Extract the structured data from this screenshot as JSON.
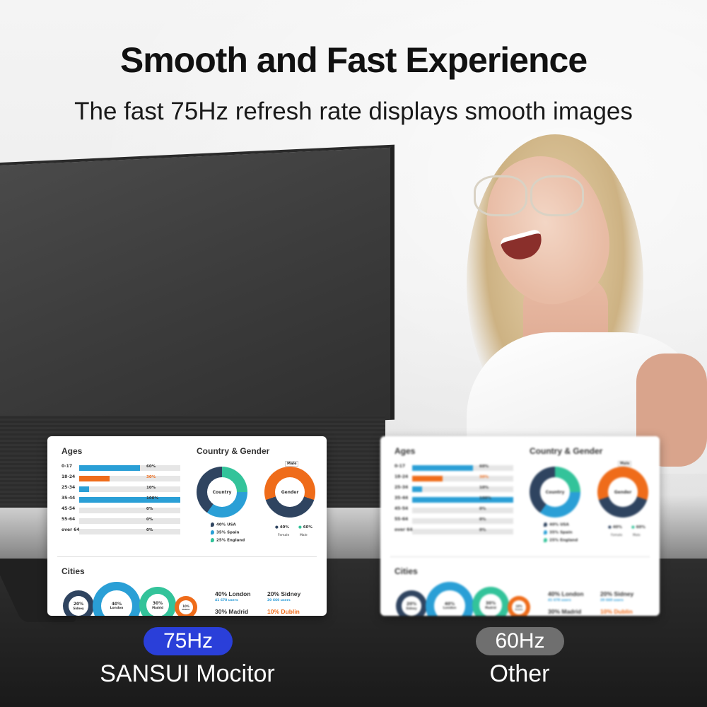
{
  "headline": "Smooth and Fast Experience",
  "subheadline": "The fast 75Hz refresh rate displays smooth images",
  "colors": {
    "blue": "#2a9fd6",
    "orange": "#ef6c1a",
    "teal": "#33c39a",
    "navy": "#2f4460",
    "badge_75": "#2a3fd9",
    "badge_60": "#6f6f6f"
  },
  "dashboard": {
    "ages_title": "Ages",
    "country_gender_title": "Country & Gender",
    "cities_title": "Cities",
    "ages": [
      {
        "label": "0-17",
        "pct": "60%",
        "value": 0.6,
        "color": "#2a9fd6"
      },
      {
        "label": "18-24",
        "pct": "30%",
        "value": 0.3,
        "color": "#ef6c1a"
      },
      {
        "label": "25-34",
        "pct": "10%",
        "value": 0.1,
        "color": "#2a9fd6"
      },
      {
        "label": "35-44",
        "pct": "100%",
        "value": 1.0,
        "color": "#2a9fd6"
      },
      {
        "label": "45-54",
        "pct": "0%",
        "value": 0,
        "color": "#2a9fd6"
      },
      {
        "label": "55-64",
        "pct": "0%",
        "value": 0,
        "color": "#2a9fd6"
      },
      {
        "label": "over 64",
        "pct": "0%",
        "value": 0,
        "color": "#2a9fd6"
      }
    ],
    "country_donut": {
      "label": "Country",
      "pct_left": "40%",
      "pct_right": "25%",
      "pct_bottom": "35%"
    },
    "gender_donut": {
      "label": "Gender",
      "tag": "Male",
      "pct_top": "60%",
      "pct_bottom": "40%"
    },
    "countries": [
      "40% USA",
      "35% Spain",
      "25% England"
    ],
    "gender_legend": {
      "female_pct": "40%",
      "male_pct": "60%",
      "female": "Female",
      "male": "Male"
    },
    "cities": [
      {
        "pct": "20%",
        "name": "Sidney"
      },
      {
        "pct": "40%",
        "name": "London"
      },
      {
        "pct": "30%",
        "name": "Madrid"
      },
      {
        "pct": "10%",
        "name": "Dublin"
      }
    ],
    "city_stats": {
      "london": "40% London",
      "london_sub": "41 678 users",
      "sidney": "20% Sidney",
      "sidney_sub": "20 660 users",
      "madrid": "30% Madrid",
      "dublin": "10% Dublin"
    }
  },
  "left_badge": "75Hz",
  "left_caption": "SANSUI Mocitor",
  "right_badge": "60Hz",
  "right_caption": "Other"
}
